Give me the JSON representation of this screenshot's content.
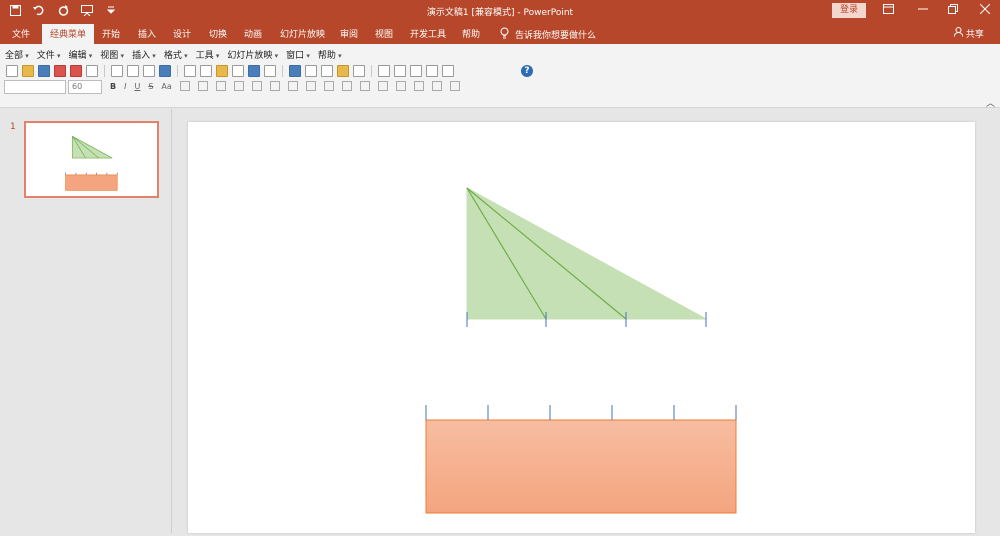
{
  "titlebar": {
    "title": "演示文稿1 [兼容模式] - PowerPoint",
    "login_label": "登录",
    "qat_icons": [
      "save-icon",
      "undo-icon",
      "redo-icon",
      "slideshow-icon",
      "customize-icon"
    ],
    "window_controls": [
      "ribbon-display-icon",
      "minimize-icon",
      "restore-icon",
      "close-icon"
    ]
  },
  "ribbon": {
    "tabs": [
      "文件",
      "经典菜单",
      "开始",
      "插入",
      "设计",
      "切换",
      "动画",
      "幻灯片放映",
      "审阅",
      "视图",
      "开发工具",
      "帮助"
    ],
    "active_tab": "经典菜单",
    "tell_me": "告诉我你想要做什么",
    "share": "共享"
  },
  "classic_menu": [
    "全部",
    "文件",
    "编辑",
    "视图",
    "插入",
    "格式",
    "工具",
    "幻灯片放映",
    "窗口",
    "帮助"
  ],
  "format": {
    "font_name": "",
    "font_size": "60",
    "bold": "B",
    "italic": "I",
    "underline": "U",
    "strike": "S",
    "case": "Aa"
  },
  "thumbnails": [
    {
      "number": "1"
    }
  ],
  "colors": {
    "accent": "#b7472a",
    "triangle_fill": "#c5e0b4",
    "triangle_stroke": "#70ad47",
    "rect_fill_top": "#f7bda1",
    "rect_fill_bottom": "#f4a57f",
    "rect_stroke": "#ed7d31",
    "tick": "#4472c4"
  }
}
